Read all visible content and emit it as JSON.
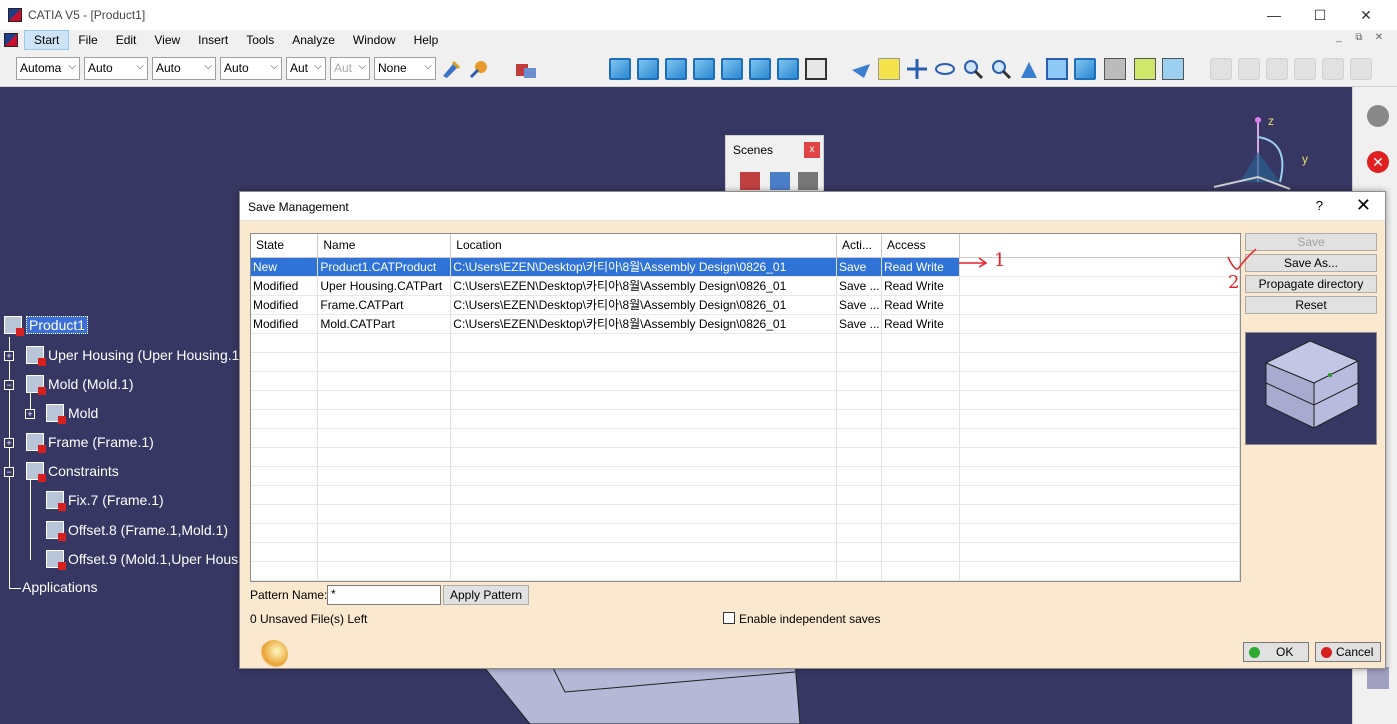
{
  "window": {
    "title": "CATIA V5 - [Product1]",
    "controls": {
      "minimize": "—",
      "maximize": "☐",
      "close": "✕"
    }
  },
  "menubar": {
    "items": [
      "Start",
      "File",
      "Edit",
      "View",
      "Insert",
      "Tools",
      "Analyze",
      "Window",
      "Help"
    ],
    "active": "Start",
    "mdi_controls": [
      "_",
      "⧉",
      "✕"
    ]
  },
  "toolbar": {
    "selects": [
      "Automa",
      "Auto",
      "Auto",
      "Auto",
      "Aut",
      "Aut",
      "None"
    ],
    "disabled_select_index": 5,
    "chevron": "⌵"
  },
  "scenes": {
    "title": "Scenes",
    "close": "x"
  },
  "tree": {
    "root": "Product1",
    "items": [
      "Uper Housing (Uper Housing.1",
      "Mold (Mold.1)",
      "Mold",
      "Frame (Frame.1)",
      "Constraints",
      "Fix.7 (Frame.1)",
      "Offset.8 (Frame.1,Mold.1)",
      "Offset.9 (Mold.1,Uper Hous",
      "Applications"
    ],
    "toggles": {
      "collapsed": "+",
      "expanded": "−"
    }
  },
  "compass": {
    "z": "z",
    "y": "y"
  },
  "dialog": {
    "title": "Save Management",
    "help": "?",
    "close": "✕",
    "columns": [
      "State",
      "Name",
      "Location",
      "Acti...",
      "Access"
    ],
    "rows": [
      {
        "state": "New",
        "name": "Product1.CATProduct",
        "location": "C:\\Users\\EZEN\\Desktop\\카티아\\8월\\Assembly Design\\0826_01",
        "action": "Save",
        "access": "Read Write"
      },
      {
        "state": "Modified",
        "name": "Uper Housing.CATPart",
        "location": "C:\\Users\\EZEN\\Desktop\\카티아\\8월\\Assembly Design\\0826_01",
        "action": "Save ...",
        "access": "Read Write"
      },
      {
        "state": "Modified",
        "name": "Frame.CATPart",
        "location": "C:\\Users\\EZEN\\Desktop\\카티아\\8월\\Assembly Design\\0826_01",
        "action": "Save ...",
        "access": "Read Write"
      },
      {
        "state": "Modified",
        "name": "Mold.CATPart",
        "location": "C:\\Users\\EZEN\\Desktop\\카티아\\8월\\Assembly Design\\0826_01",
        "action": "Save ...",
        "access": "Read Write"
      }
    ],
    "buttons": {
      "save": "Save",
      "save_as": "Save As...",
      "propagate": "Propagate directory",
      "reset": "Reset"
    },
    "pattern_label": "Pattern Name:",
    "pattern_value": "*",
    "apply_pattern": "Apply Pattern",
    "unsaved": "0 Unsaved File(s) Left",
    "enable_independent": "Enable independent saves",
    "ok": "OK",
    "cancel": "Cancel"
  },
  "annotations": {
    "one": "1",
    "two": "2"
  },
  "colors": {
    "viewport_bg": "#373764",
    "dialog_bg": "#fbe9cf",
    "selection": "#2f73d6",
    "annotation": "#e8202a",
    "ok_dot": "#2eaa2e",
    "cancel_dot": "#d62020"
  }
}
